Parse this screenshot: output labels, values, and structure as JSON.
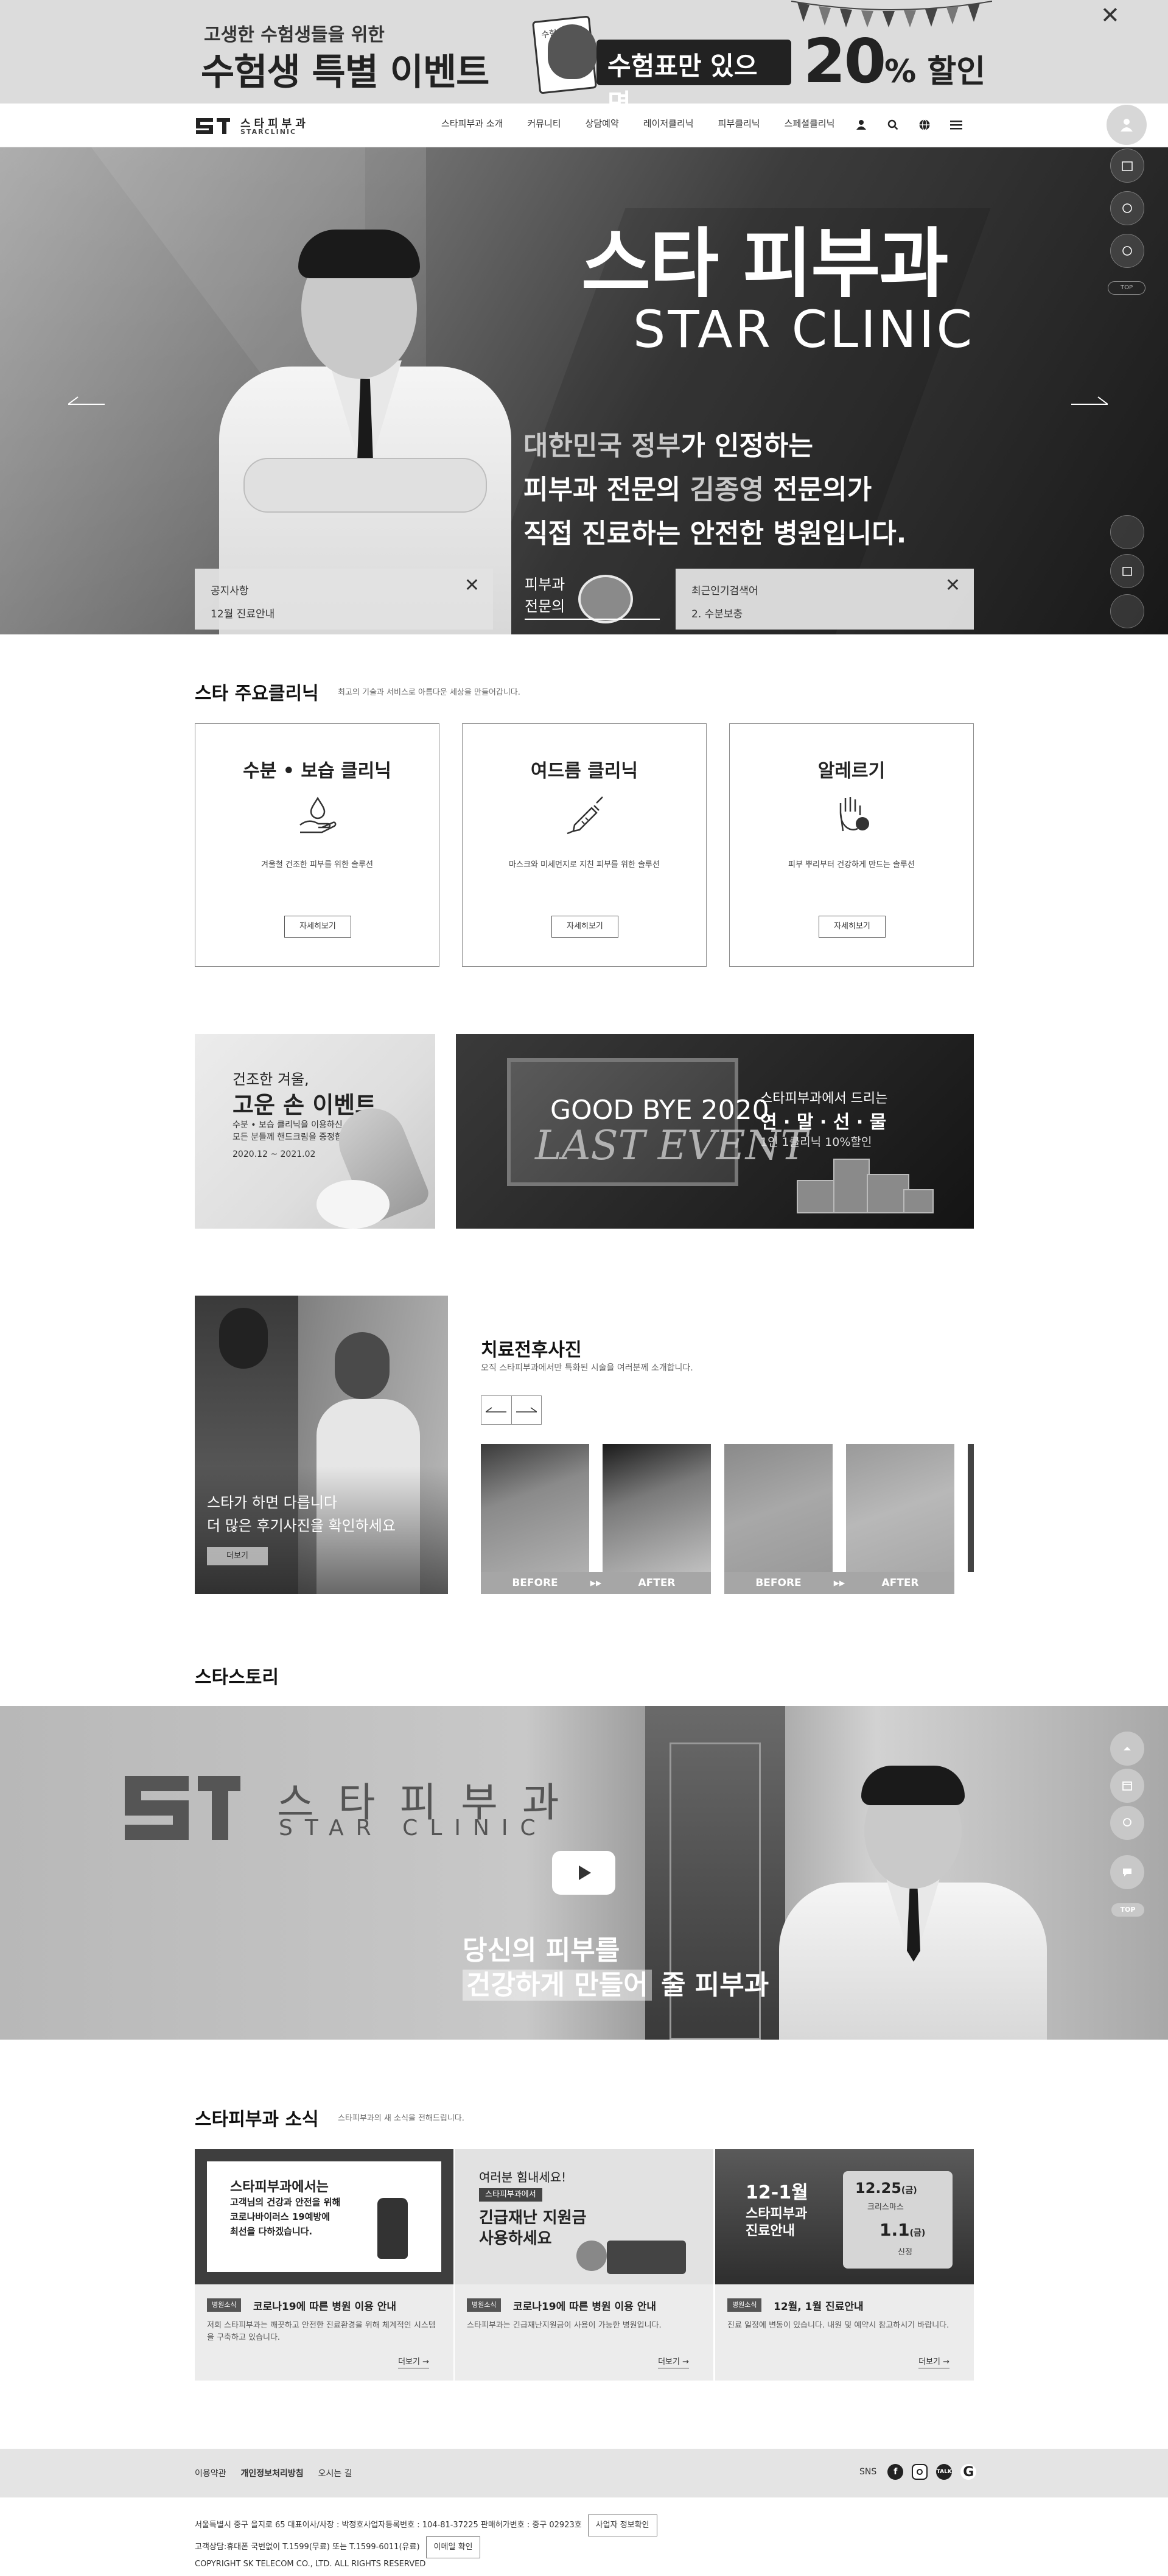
{
  "top_banner": {
    "line1": "고생한 수험생들을 위한",
    "line2": "수험생 특별 이벤트",
    "card_text": "수험표",
    "badge": "수험표만 있으면",
    "percent": "20",
    "percent_suffix": "% 할인",
    "close_icon": "close-icon"
  },
  "header": {
    "logo_ko": "스타피부과",
    "logo_en": "STARCLINIC",
    "nav": [
      "스타피부과 소개",
      "커뮤니티",
      "상담예약",
      "레이저클리닉",
      "피부클리닉",
      "스페셜클리닉"
    ],
    "icons": [
      "user-icon",
      "search-icon",
      "globe-icon",
      "menu-icon"
    ]
  },
  "hero": {
    "title": "스타 피부과",
    "title_en": "STAR CLINIC",
    "sub_line1_dim": "대한민국 정부",
    "sub_line1": "가 인정하는",
    "sub_line2_a": "피부과 전문의 ",
    "sub_line2_dim": "김종영",
    "sub_line2_b": " 전문의가",
    "sub_line3": "직접 진료하는 안전한 병원입니다.",
    "notice": {
      "title": "공지사항",
      "item": "12월 진료안내"
    },
    "specialist_line1": "피부과",
    "specialist_line2": "전문의",
    "popular": {
      "title": "최근인기검색어",
      "item": "2. 수분보충"
    }
  },
  "side_quick": {
    "top_label": "TOP"
  },
  "clinics": {
    "title": "스타 주요클리닉",
    "desc": "최고의 기술과 서비스로 아름다운 세상을 만들어갑니다.",
    "cards": [
      {
        "title": "수분 • 보습 클리닉",
        "desc": "겨울철 건조한 피부를 위한 솔루션",
        "button": "자세히보기",
        "icon": "hand-drop-icon"
      },
      {
        "title": "여드름 클리닉",
        "desc": "마스크와 미세먼지로 지친 피부를 위한 솔루션",
        "button": "자세히보기",
        "icon": "syringe-icon"
      },
      {
        "title": "알레르기",
        "desc": "피부 뿌리부터 건강하게 만드는 솔루션",
        "button": "자세히보기",
        "icon": "allergy-hand-icon"
      }
    ]
  },
  "events": {
    "small": {
      "line1": "건조한 겨울,",
      "line2": "고운 손 이벤트",
      "line3": "수분 • 보습 클리닉을 이용하신",
      "line4": "모든 분들께 핸드크림을 증정합니다.",
      "date": "2020.12 ~ 2021.02"
    },
    "big": {
      "good": "GOOD BYE 2020",
      "last": "LAST EVENT",
      "r1": "스타피부과에서 드리는",
      "r2": "연 · 말 · 선 · 물",
      "r3": "1인 1클리닉 10%할인"
    }
  },
  "reviews": {
    "photo_line1": "스타가 하면 다릅니다",
    "photo_line2": "더 많은 후기사진을 확인하세요",
    "photo_button": "더보기",
    "title": "치료전후사진",
    "desc": "오직 스타피부과에서만 특화된 시술을 여러분께 소개합니다.",
    "labels": [
      "BEFORE",
      "AFTER",
      "BEFORE",
      "AFTER"
    ]
  },
  "story": {
    "title": "스타스토리",
    "logo_ko": "스타피부과",
    "logo_en": "STAR CLINIC",
    "caption1": "당신의 피부를",
    "caption2_hl": "건강하게 만들어",
    "caption2_rest": " 줄 피부과"
  },
  "news": {
    "title": "스타피부과 소식",
    "desc": "스타피부과의 새 소식을 전해드립니다.",
    "cards": [
      {
        "img_l1": "스타피부과에서는",
        "img_l2": "고객님의 건강과 안전을 위해",
        "img_l3": "코로나바이러스 19예방에",
        "img_l4": "최선을 다하겠습니다.",
        "tag": "병원소식",
        "title": "코로나19에 따른 병원 이용 안내",
        "desc": "저희 스타피부과는 깨끗하고 안전한 진료환경을 위해 체계적인 시스템을 구축하고 있습니다.",
        "more": "더보기 →"
      },
      {
        "img_l1": "여러분 힘내세요!",
        "img_badge": "스타피부과에서",
        "img_l2": "긴급재난 지원금",
        "img_l3": "사용하세요",
        "tag": "병원소식",
        "title": "코로나19에 따른 병원 이용 안내",
        "desc": "스타피부과는 긴급재난지원금이 사용이 가능한 병원입니다.",
        "more": "더보기 →"
      },
      {
        "img_l1": "12-1월",
        "img_l2": "스타피부과",
        "img_l3": "진료안내",
        "img_d1": "12.25",
        "img_d1_day": "(금)",
        "img_d1_t": "크리스마스",
        "img_d2": "1.1",
        "img_d2_day": "(금)",
        "img_d2_t": "신정",
        "tag": "병원소식",
        "title": "12월, 1월 진료안내",
        "desc": "진료 일정에 변동이 있습니다. 내원 및 예약시 참고하시기 바랍니다.",
        "more": "더보기 →"
      }
    ]
  },
  "footer": {
    "links": [
      "이용약관",
      "개인정보처리방침",
      "오시는 길"
    ],
    "sns_label": "SNS",
    "sns_icons": [
      "facebook-icon",
      "instagram-icon",
      "talk-icon",
      "google-icon"
    ],
    "info_line1": "서울특별시 중구 을지로 65 대표이사/사장 : 박정호사업자등록번호 : 104-81-37225 판매허가번호 : 중구 02923호",
    "info_btn1": "사업자 정보확인",
    "info_line2": "고객상담:휴대폰 국번없이 T.1599(무료) 또는 T.1599-6011(유료)",
    "info_btn2": "이메일 확인",
    "copyright": "COPYRIGHT SK TELECOM CO., LTD. ALL RIGHTS RESERVED"
  }
}
